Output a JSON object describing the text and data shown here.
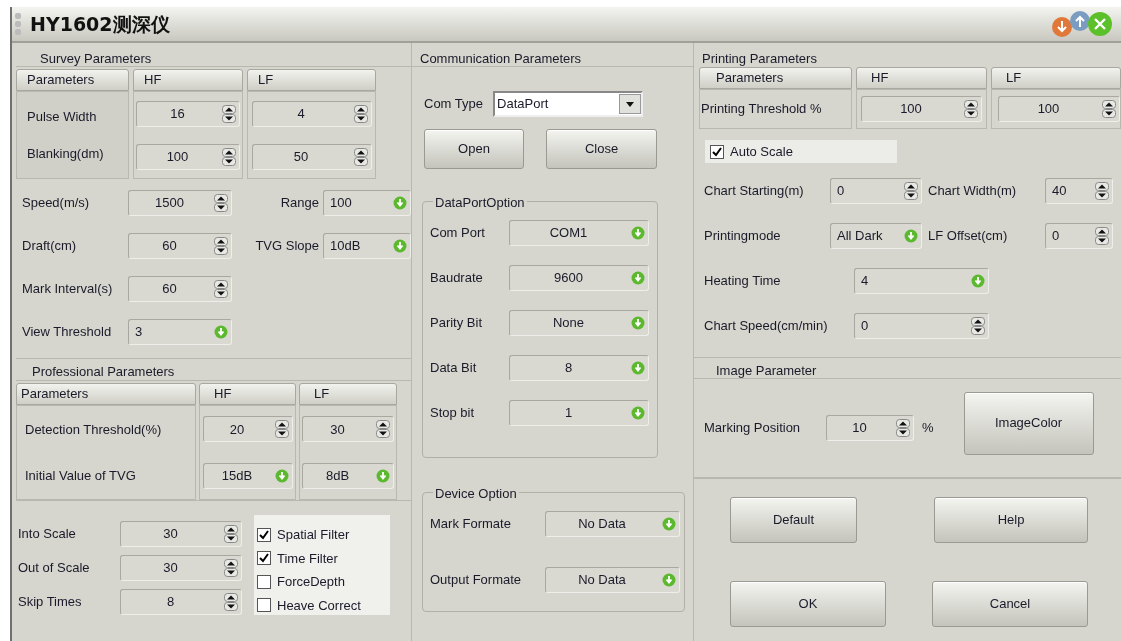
{
  "window": {
    "title": "HY1602测深仪"
  },
  "survey": {
    "title": "Survey Parameters",
    "columns": [
      "Parameters",
      "HF",
      "LF"
    ],
    "rows": [
      {
        "label": "Pulse Width",
        "hf": "16",
        "lf": "4"
      },
      {
        "label": "Blanking(dm)",
        "hf": "100",
        "lf": "50"
      }
    ],
    "field_rows": [
      [
        {
          "label": "Speed(m/s)",
          "value": "1500",
          "kind": "spinner"
        },
        {
          "label": "Range",
          "value": "100",
          "kind": "dropdown"
        }
      ],
      [
        {
          "label": "Draft(cm)",
          "value": "60",
          "kind": "spinner"
        },
        {
          "label": "TVG Slope",
          "value": "10dB",
          "kind": "dropdown"
        }
      ],
      [
        {
          "label": "Mark Interval(s)",
          "value": "60",
          "kind": "spinner"
        }
      ],
      [
        {
          "label": "View Threshold",
          "value": "3",
          "kind": "dropdown"
        }
      ]
    ]
  },
  "professional": {
    "title": "Professional Parameters",
    "columns": [
      "Parameters",
      "HF",
      "LF"
    ],
    "rows": [
      {
        "label": "Detection Threshold(%)",
        "kind": "spinner",
        "hf": "20",
        "lf": "30"
      },
      {
        "label": "Initial Value of TVG",
        "kind": "dropdown",
        "hf": "15dB",
        "lf": "8dB"
      }
    ]
  },
  "scale_fields": [
    {
      "label": "Into Scale",
      "value": "30"
    },
    {
      "label": "Out of Scale",
      "value": "30"
    },
    {
      "label": "Skip Times",
      "value": "8"
    }
  ],
  "filters": [
    {
      "label": "Spatial Filter",
      "checked": true
    },
    {
      "label": "Time Filter",
      "checked": true
    },
    {
      "label": "ForceDepth",
      "checked": false
    },
    {
      "label": "Heave Correct",
      "checked": false
    }
  ],
  "communication": {
    "title": "Communication Parameters",
    "com_type": {
      "label": "Com Type",
      "value": "DataPort"
    },
    "buttons": [
      "Open",
      "Close"
    ],
    "dataport": {
      "title": "DataPortOption",
      "fields": [
        {
          "label": "Com Port",
          "value": "COM1"
        },
        {
          "label": "Baudrate",
          "value": "9600"
        },
        {
          "label": "Parity Bit",
          "value": "None"
        },
        {
          "label": "Data Bit",
          "value": "8"
        },
        {
          "label": "Stop bit",
          "value": "1"
        }
      ]
    },
    "device": {
      "title": "Device Option",
      "fields": [
        {
          "label": "Mark Formate",
          "value": "No Data"
        },
        {
          "label": "Output Formate",
          "value": "No Data"
        }
      ]
    }
  },
  "printing": {
    "title": "Printing Parameters",
    "columns": [
      "Parameters",
      "HF",
      "LF"
    ],
    "row": {
      "label": "Printing Threshold %",
      "hf": "100",
      "lf": "100"
    },
    "auto_scale": {
      "label": "Auto Scale",
      "checked": true
    },
    "field_rows": [
      [
        {
          "label": "Chart Starting(m)",
          "value": "0",
          "kind": "spinner"
        },
        {
          "label": "Chart Width(m)",
          "value": "40",
          "kind": "spinner"
        }
      ],
      [
        {
          "label": "Printingmode",
          "value": "All Dark",
          "kind": "dropdown"
        },
        {
          "label": "LF Offset(cm)",
          "value": "0",
          "kind": "spinner"
        }
      ],
      [
        {
          "label": "Heating Time",
          "value": "4",
          "kind": "dropdown"
        }
      ],
      [
        {
          "label": "Chart Speed(cm/min)",
          "value": "0",
          "kind": "spinner"
        }
      ]
    ]
  },
  "image": {
    "title": "Image Parameter",
    "marking": {
      "label": "Marking Position",
      "value": "10",
      "unit": "%"
    },
    "button": "ImageColor"
  },
  "buttons": [
    "Default",
    "Help",
    "OK",
    "Cancel"
  ]
}
